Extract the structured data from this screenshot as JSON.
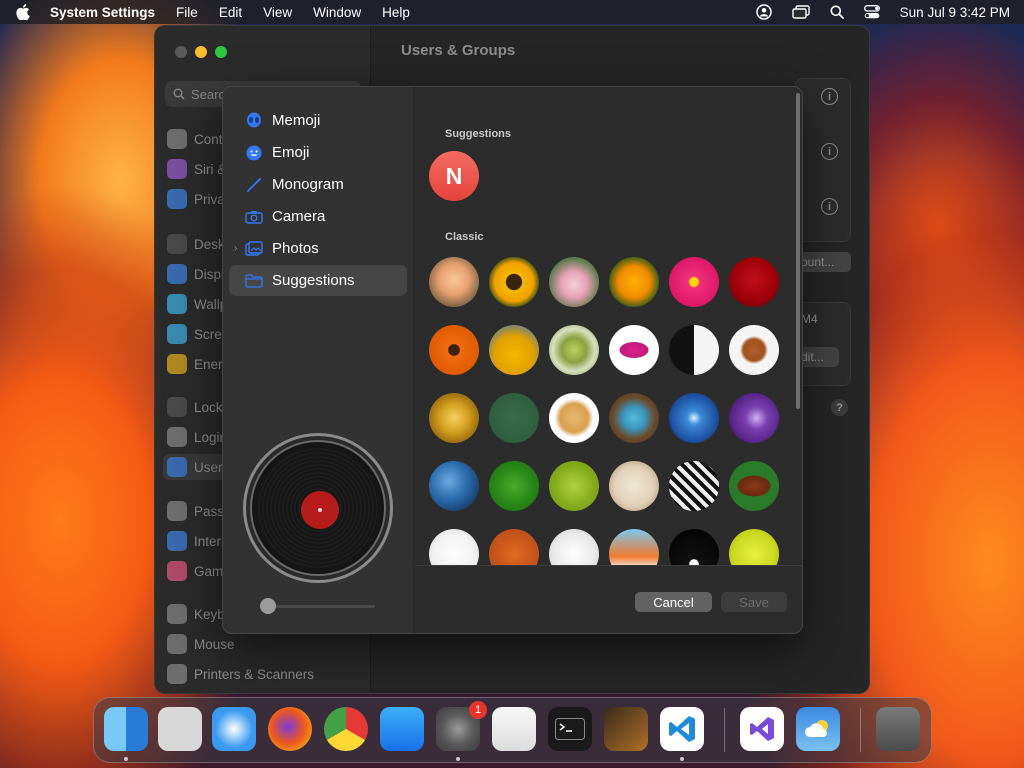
{
  "menubar": {
    "app_name": "System Settings",
    "menus": [
      "File",
      "Edit",
      "View",
      "Window",
      "Help"
    ],
    "clock": "Sun Jul 9  3:42 PM"
  },
  "settings": {
    "title": "Users & Groups",
    "search_placeholder": "Search",
    "sidebar": [
      {
        "label": "Control Centre",
        "color": "#6e6e6e"
      },
      {
        "label": "Siri & Spotlight",
        "color": "#7a4fa0"
      },
      {
        "label": "Privacy & Security",
        "color": "#3a6bb0"
      },
      {
        "label": "Desktop & Dock",
        "color": "#4a4a4a"
      },
      {
        "label": "Displays",
        "color": "#3a6bb0"
      },
      {
        "label": "Wallpaper",
        "color": "#3a8ab0"
      },
      {
        "label": "Screen Saver",
        "color": "#3a8ab0"
      },
      {
        "label": "Energy Saver",
        "color": "#b08a20"
      },
      {
        "label": "Lock Screen",
        "color": "#4a4a4a"
      },
      {
        "label": "Login Password",
        "color": "#6e6e6e"
      },
      {
        "label": "Users & Groups",
        "color": "#3a6bb0"
      },
      {
        "label": "Passwords",
        "color": "#6e6e6e"
      },
      {
        "label": "Internet Accounts",
        "color": "#3a6bb0"
      },
      {
        "label": "Game Center",
        "color": "#b04a6a"
      },
      {
        "label": "Keyboard",
        "color": "#6e6e6e"
      },
      {
        "label": "Mouse",
        "color": "#6e6e6e"
      },
      {
        "label": "Printers & Scanners",
        "color": "#6e6e6e"
      }
    ],
    "background_buttons": {
      "add_account": "ount...",
      "edit": "dit...",
      "stepper_value": "M4"
    }
  },
  "picker": {
    "sources": [
      {
        "label": "Memoji",
        "icon": "memoji-icon"
      },
      {
        "label": "Emoji",
        "icon": "emoji-icon"
      },
      {
        "label": "Monogram",
        "icon": "pencil-icon"
      },
      {
        "label": "Camera",
        "icon": "camera-icon"
      },
      {
        "label": "Photos",
        "icon": "photos-icon"
      },
      {
        "label": "Suggestions",
        "icon": "folder-icon"
      }
    ],
    "selected_source": "Suggestions",
    "suggestions_label": "Suggestions",
    "monogram_letter": "N",
    "classic_label": "Classic",
    "classic_images": [
      "rose-peach",
      "sunflower",
      "lotus",
      "poppy",
      "pink-dahlia",
      "red-rose",
      "orange-gerbera",
      "sunflower-field",
      "dandelion",
      "lips",
      "yin-yang",
      "gingerbread",
      "gold-medal",
      "chalkboard",
      "fortune-cookie",
      "eggs-nest",
      "snowflake",
      "lightning",
      "earth",
      "leaf",
      "cactus",
      "sand-dollar",
      "zebra",
      "football",
      "baseball",
      "basketball",
      "golf-ball",
      "surfboard",
      "eight-ball",
      "tennis-ball"
    ],
    "cancel_label": "Cancel",
    "save_label": "Save"
  },
  "dock": {
    "apps": [
      "Finder",
      "Launchpad",
      "Safari",
      "Firefox",
      "Chrome",
      "App Store",
      "System Settings",
      "TextEdit",
      "Terminal",
      "GarageBand",
      "Visual Studio Code",
      "Visual Studio",
      "Weather",
      "Trash"
    ],
    "settings_badge": "1"
  }
}
